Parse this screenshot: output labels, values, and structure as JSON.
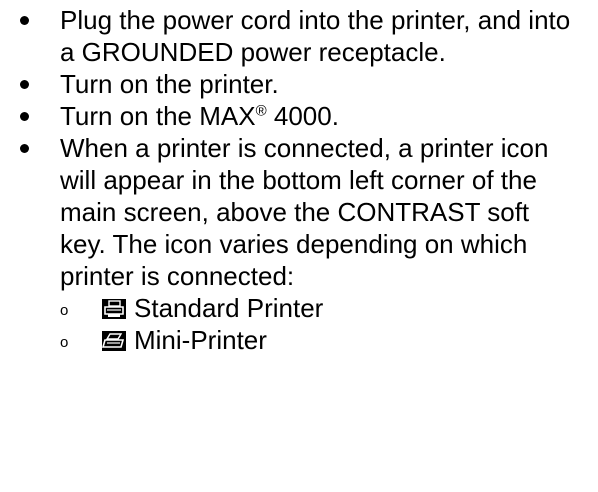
{
  "bullets": [
    {
      "text": "Plug the power cord into the printer, and into a GROUNDED power receptacle."
    },
    {
      "text": "Turn on the printer."
    },
    {
      "pre": "Turn on the MAX",
      "sup": "®",
      "post": " 4000."
    },
    {
      "text": "When a printer is connected, a printer icon will appear in the bottom left corner of the main screen, above the CONTRAST soft key.  The icon varies depending on which printer is connected:"
    }
  ],
  "sub_items": [
    {
      "marker": "o",
      "icon": "standard-printer-icon",
      "label": "Standard Printer"
    },
    {
      "marker": "o",
      "icon": "mini-printer-icon",
      "label": "Mini-Printer"
    }
  ],
  "colors": {
    "text": "#000000",
    "icon_bg": "#000000",
    "icon_fg": "#ffffff"
  }
}
